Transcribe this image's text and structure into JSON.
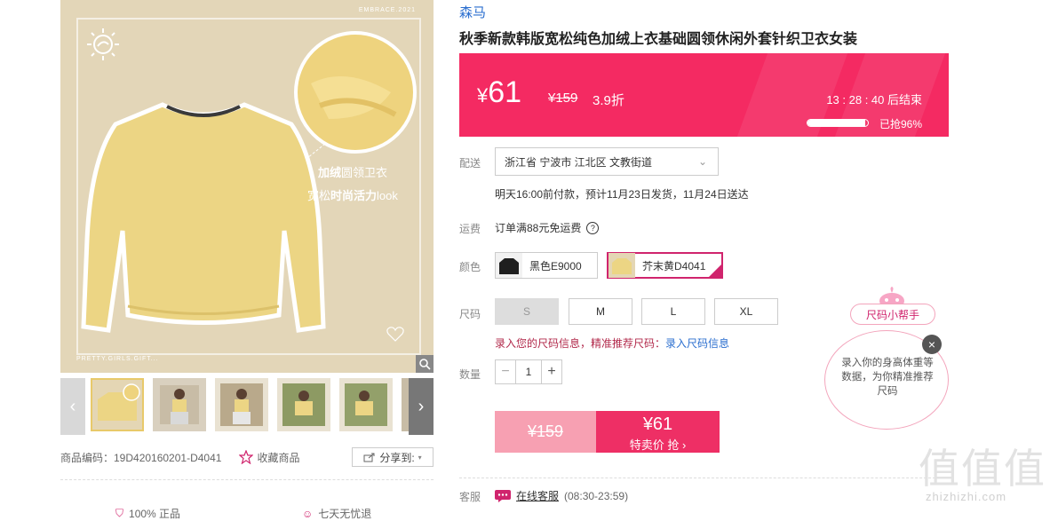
{
  "gallery": {
    "tag_top": "EMBRACE.2021",
    "tag_bottom": "PRETTY.GIRLS.GIFT...",
    "promo_line1_bold": "加绒",
    "promo_line1_rest": "圆领卫衣",
    "promo_line2_pre": "宽松",
    "promo_line2_bold": "时尚活力",
    "promo_line2_post": "look",
    "zoom_icon": "magnifier-icon",
    "thumbnail_count": 5
  },
  "meta": {
    "product_code": "商品编码：19D420160201-D4041",
    "favorite": "收藏商品",
    "share": "分享到:"
  },
  "guarantees": [
    "100% 正品",
    "七天无忧退"
  ],
  "product": {
    "brand": "森马",
    "title": "秋季新款韩版宽松纯色加绒上衣基础圆领休闲外套针织卫衣女装"
  },
  "price": {
    "currency": "¥",
    "now": "61",
    "original": "¥159",
    "discount": "3.9折",
    "countdown": "13 : 28 : 40  后结束",
    "sold_text": "已抢96%",
    "sold_fraction": 0.96
  },
  "delivery": {
    "label": "配送",
    "address": "浙江省 宁波市 江北区 文教街道",
    "note": "明天16:00前付款，预计11月23日发货，11月24日送达"
  },
  "shipping": {
    "label": "运费",
    "text": "订单满88元免运费"
  },
  "colors": {
    "label": "颜色",
    "options": [
      {
        "name": "黑色E9000",
        "selected": false
      },
      {
        "name": "芥末黄D4041",
        "selected": true
      }
    ]
  },
  "sizes": {
    "label": "尺码",
    "options": [
      "S",
      "M",
      "L",
      "XL"
    ],
    "disabled": [
      "S"
    ],
    "hint_prefix": "录入您的尺码信息，精准推荐尺码：",
    "hint_link": "录入尺码信息"
  },
  "quantity": {
    "label": "数量",
    "value": "1",
    "minus": "−",
    "plus": "+"
  },
  "buy": {
    "original": "¥159",
    "special_price": "¥61",
    "special_label": "特卖价 抢 ›"
  },
  "service": {
    "label": "客服",
    "link": "在线客服",
    "hours": "(08:30-23:59)"
  },
  "size_helper": {
    "title": "尺码小帮手",
    "text": "录入你的身高体重等数据，为你精准推荐尺码"
  },
  "watermark": {
    "big": "值值值",
    "url": "zhizhizhi.com"
  },
  "colors_theme": {
    "accent": "#f42a62",
    "link": "#2a6ecf",
    "pink_border": "#d0246d"
  }
}
